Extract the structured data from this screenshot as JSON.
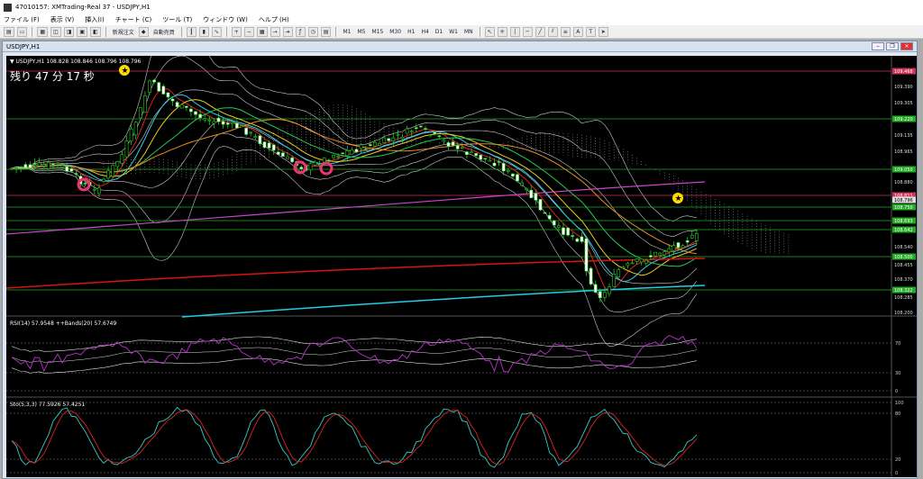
{
  "window": {
    "title": "47010157: XMTrading-Real 37 - USDJPY,H1"
  },
  "menu": [
    "ファイル (F)",
    "表示 (V)",
    "挿入(I)",
    "チャート (C)",
    "ツール (T)",
    "ウィンドウ (W)",
    "ヘルプ (H)"
  ],
  "toolbar": {
    "new_order": "新規注文",
    "auto_trade": "自動売買",
    "timeframes": [
      "M1",
      "M5",
      "M15",
      "M30",
      "H1",
      "H4",
      "D1",
      "W1",
      "MN"
    ]
  },
  "chart_window": {
    "title": "USDJPY,H1"
  },
  "chart": {
    "header": "▼ USDJPY,H1  108.828 108.846 108.796 108.796",
    "countdown": "残り 47 分 17 秒",
    "price_ticks": [
      "109.390",
      "109.305",
      "109.135",
      "108.965",
      "108.880",
      "108.625",
      "108.540",
      "108.455",
      "108.370",
      "108.285",
      "108.200"
    ],
    "price_labels": [
      {
        "text": "109.468",
        "color": "#cc3355"
      },
      {
        "text": "109.220",
        "color": "#22aa22"
      },
      {
        "text": "109.050",
        "color": "#22aa22"
      },
      {
        "text": "108.811",
        "color": "#cc3355"
      },
      {
        "text": "108.796",
        "color": "#dddddd"
      },
      {
        "text": "108.750",
        "color": "#22aa22"
      },
      {
        "text": "108.693",
        "color": "#22aa22"
      },
      {
        "text": "108.642",
        "color": "#22aa22"
      },
      {
        "text": "108.500",
        "color": "#22aa22"
      },
      {
        "text": "108.322",
        "color": "#22aa22"
      }
    ]
  },
  "rsi": {
    "header": "RSI(14) 57.9548  ++Bands(20) 57.6749",
    "ticks": [
      "70",
      "30",
      "0"
    ]
  },
  "stoch": {
    "header": "Sto(5,3,3) 77.5926 57.4251",
    "ticks": [
      "100",
      "80",
      "20",
      "0"
    ]
  }
}
